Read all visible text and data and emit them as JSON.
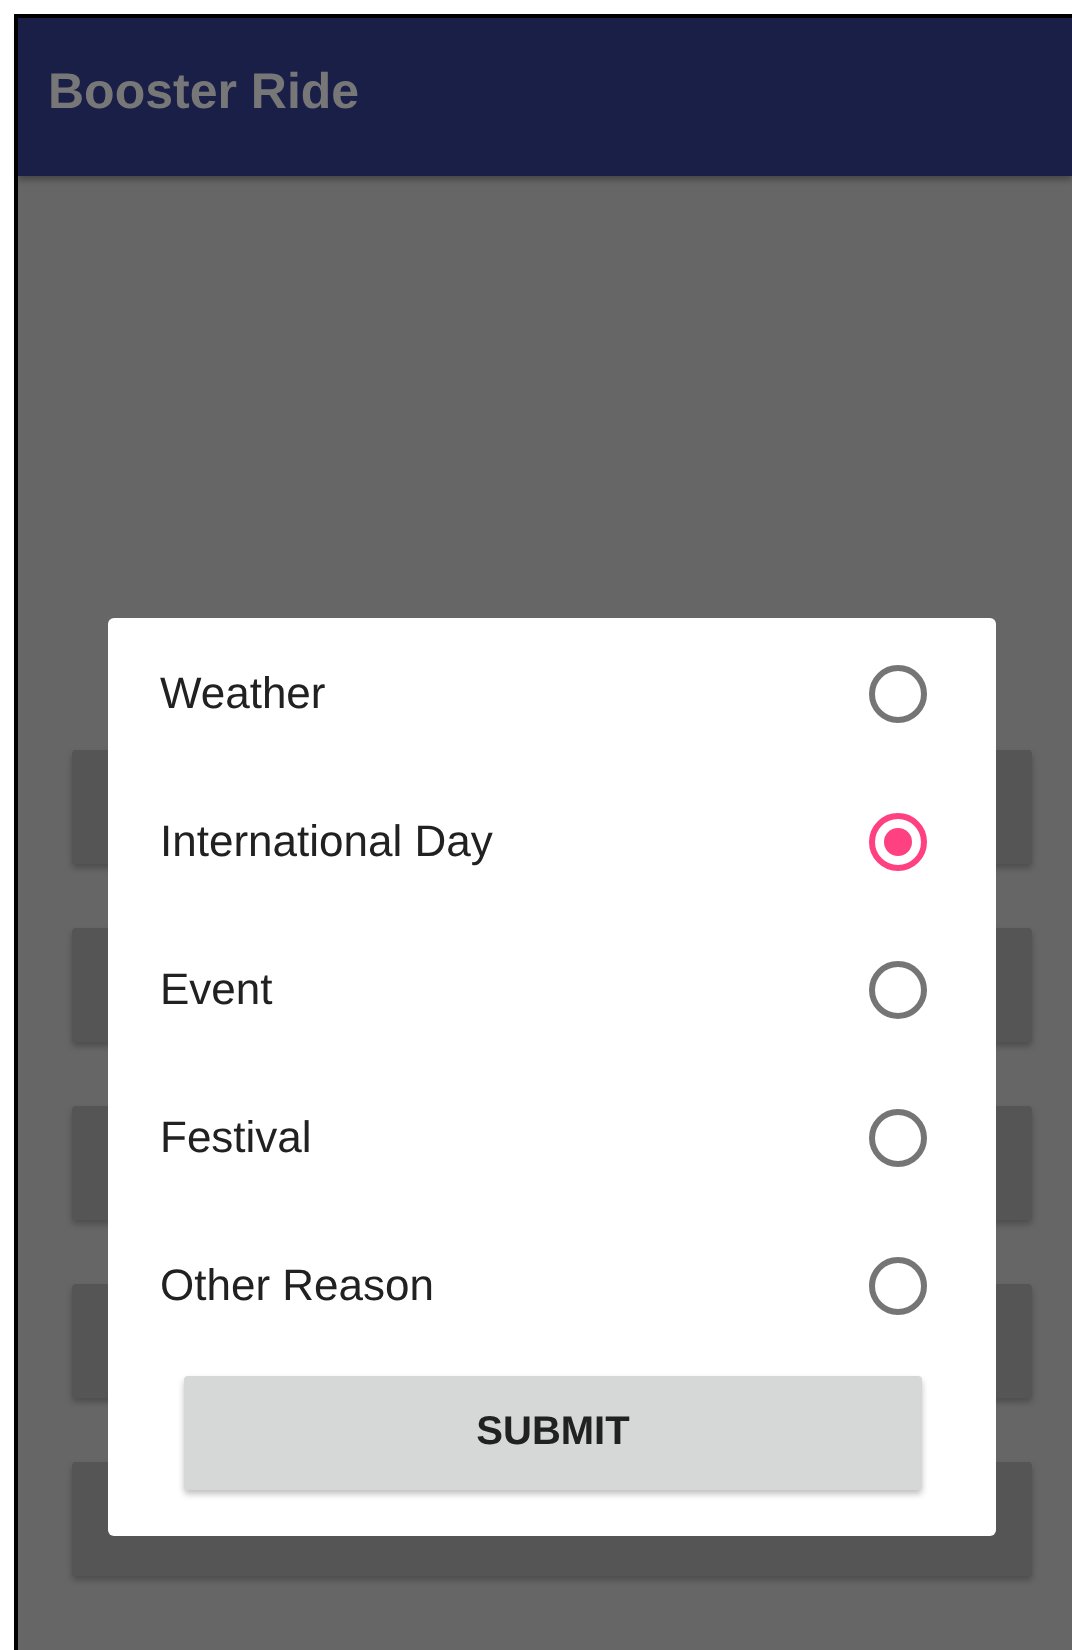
{
  "app_bar": {
    "title": "Booster Ride"
  },
  "dialog": {
    "options": [
      {
        "label": "Weather",
        "selected": false
      },
      {
        "label": "International Day",
        "selected": true
      },
      {
        "label": "Event",
        "selected": false
      },
      {
        "label": "Festival",
        "selected": false
      },
      {
        "label": "Other Reason",
        "selected": false
      }
    ],
    "submit_button": "SUBMIT"
  }
}
